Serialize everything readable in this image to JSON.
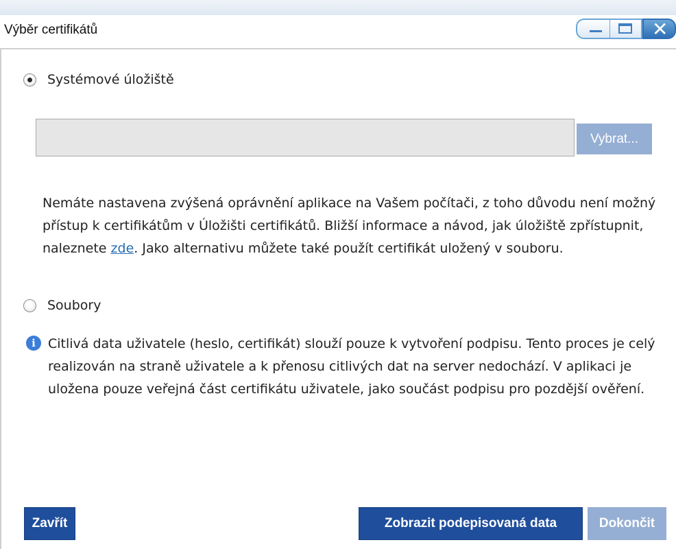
{
  "window": {
    "title": "Výběr certifikátů"
  },
  "options": {
    "system_store_label": "Systémové úložiště",
    "files_label": "Soubory",
    "selected": "system_store"
  },
  "picker": {
    "value": "",
    "select_button_label": "Vybrat..."
  },
  "permissions_message": {
    "part1": "Nemáte nastavena zvýšená oprávnění aplikace na Vašem počítači, z toho důvodu není možný přístup k certifikátům v Úložišti certifikátů. Bližší informace a návod, jak úložiště zpřístupnit, naleznete ",
    "link_text": "zde",
    "part2": ". Jako alternativu můžete také použít certifikát uložený v souboru."
  },
  "privacy_note": "Citlivá data uživatele (heslo, certifikát) slouží pouze k vytvoření podpisu. Tento proces je celý realizován na straně uživatele a k přenosu citlivých dat na server nedochází. V aplikaci je uložena pouze veřejná část certifikátu uživatele, jako součást podpisu pro pozdější ověření.",
  "buttons": {
    "close": "Zavřít",
    "show_signed_data": "Zobrazit podepisovaná data",
    "finish": "Dokončit"
  },
  "colors": {
    "primary_button": "#1f4e9c",
    "disabled_button": "#95aed3",
    "link": "#2a6db5",
    "info_icon": "#3b7dd8"
  }
}
